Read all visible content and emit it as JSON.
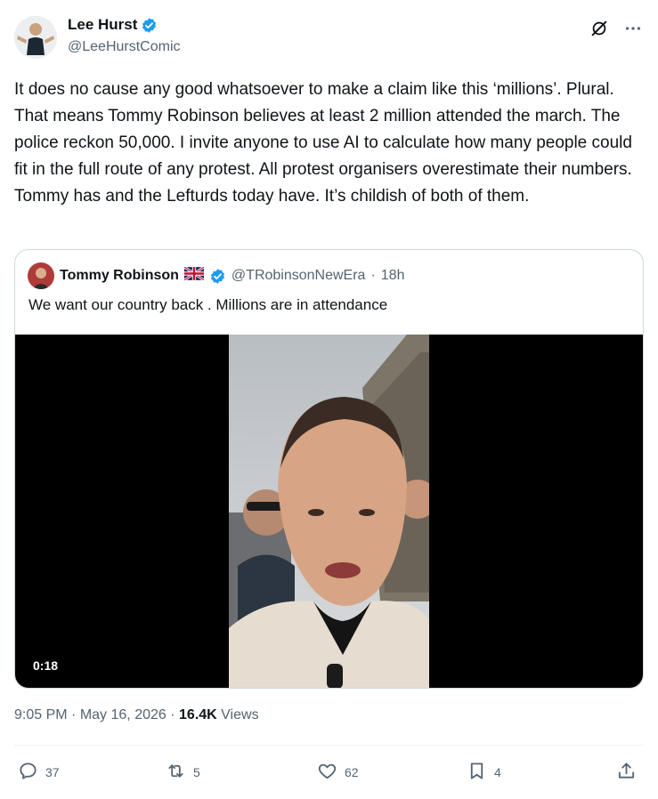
{
  "author": {
    "name": "Lee Hurst",
    "handle": "@LeeHurstComic"
  },
  "tweet": {
    "text": "It does no cause any good whatsoever to make a claim like this ‘millions’. Plural. That means Tommy Robinson believes at least 2 million attended the march. The police reckon 50,000. I invite anyone to use AI to calculate how many people could fit in the full route of any protest. All protest organisers overestimate their numbers. Tommy has and the Lefturds today have. It’s childish of both of them."
  },
  "quote": {
    "name": "Tommy Robinson",
    "flag": "🇬🇧",
    "handle": "@TRobinsonNewEra",
    "separator": "·",
    "time": "18h",
    "text": "We want our country back . Millions are in attendance",
    "video_duration": "0:18"
  },
  "meta": {
    "time": "9:05 PM",
    "separator": "·",
    "date": "May 16, 2026",
    "separator2": "·",
    "views_count": "16.4K",
    "views_label": "Views"
  },
  "actions": {
    "replies": "37",
    "reposts": "5",
    "likes": "62",
    "bookmarks": "4"
  },
  "icons": {
    "verified": "verified-badge-icon",
    "grok": "grok-slash-icon",
    "more": "more-dots-icon",
    "reply": "reply-bubble-icon",
    "repost": "repost-arrows-icon",
    "like": "heart-icon",
    "bookmark": "bookmark-icon",
    "share": "share-upload-icon"
  },
  "colors": {
    "text": "#0f1419",
    "secondary": "#536471",
    "verified": "#1d9bf0",
    "border": "#cfd9de"
  }
}
